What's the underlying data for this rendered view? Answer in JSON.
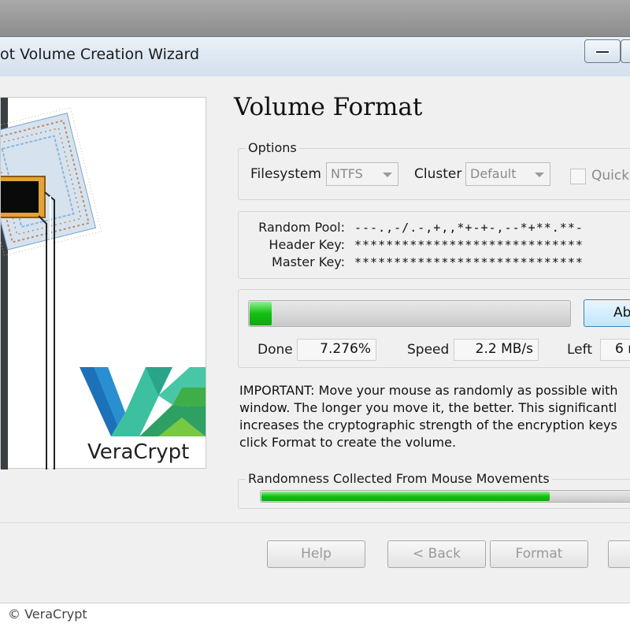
{
  "window": {
    "title": "ot Volume Creation Wizard"
  },
  "brand": {
    "logo_text": "VeraCrypt",
    "colors": {
      "teal": "#3cc0a0",
      "blue": "#1d71b8",
      "green": "#3fae49"
    }
  },
  "page": {
    "heading": "Volume Format"
  },
  "options": {
    "legend": "Options",
    "filesystem_label": "Filesystem",
    "filesystem_value": "NTFS",
    "cluster_label": "Cluster",
    "cluster_value": "Default",
    "quick_label": "Quick"
  },
  "keys": {
    "random_pool_label": "Random Pool:",
    "random_pool_value": "---.,-/.-,+,,*+-+-,--*+**.**-",
    "header_key_label": "Header Key:",
    "header_key_value": "*****************************",
    "master_key_label": "Master Key:",
    "master_key_value": "*****************************"
  },
  "progress": {
    "fraction": 0.07276,
    "abort_label": "Ab",
    "done_label": "Done",
    "done_value": "7.276%",
    "speed_label": "Speed",
    "speed_value": "2.2 MB/s",
    "left_label": "Left",
    "left_value": "6 r"
  },
  "important": {
    "lines": [
      "IMPORTANT: Move your mouse as randomly as possible with",
      "window. The longer you move it, the better. This significantl",
      "increases the cryptographic strength of the encryption keys",
      "click Format to create the volume."
    ]
  },
  "randomness": {
    "legend": "Randomness Collected From Mouse Movements",
    "fraction": 0.77
  },
  "buttons": {
    "help": "Help",
    "back": "< Back",
    "format": "Format"
  },
  "footer": {
    "copyright": "© VeraCrypt"
  }
}
